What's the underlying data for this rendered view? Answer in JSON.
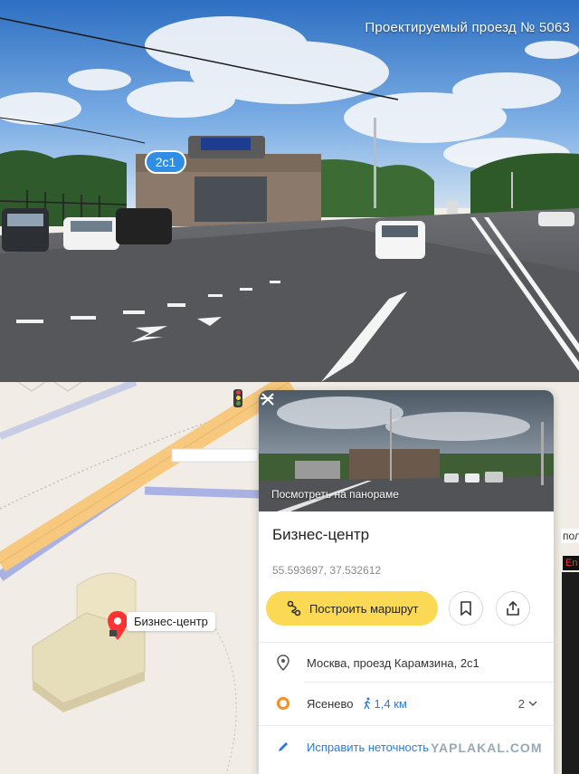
{
  "panorama": {
    "street_name": "Проектируемый проезд № 5063",
    "building_tag": "2с1"
  },
  "map": {
    "pin_label": "Бизнес-центр",
    "side_tag": "пол",
    "side_badge": "En"
  },
  "card": {
    "photo_caption": "Посмотреть на панораме",
    "title": "Бизнес-центр",
    "coordinates": "55.593697, 37.532612",
    "route_button": "Построить маршрут",
    "address": "Москва, проезд Карамзина, 2с1",
    "metro_station": "Ясенево",
    "walk_distance": "1,4 км",
    "exits_count": "2",
    "fix_link": "Исправить неточность",
    "metro_color": "#ff8c1a",
    "accent_color": "#fcd954",
    "link_color": "#2b7bd8"
  },
  "watermark": "YAPLAKAL.COM"
}
